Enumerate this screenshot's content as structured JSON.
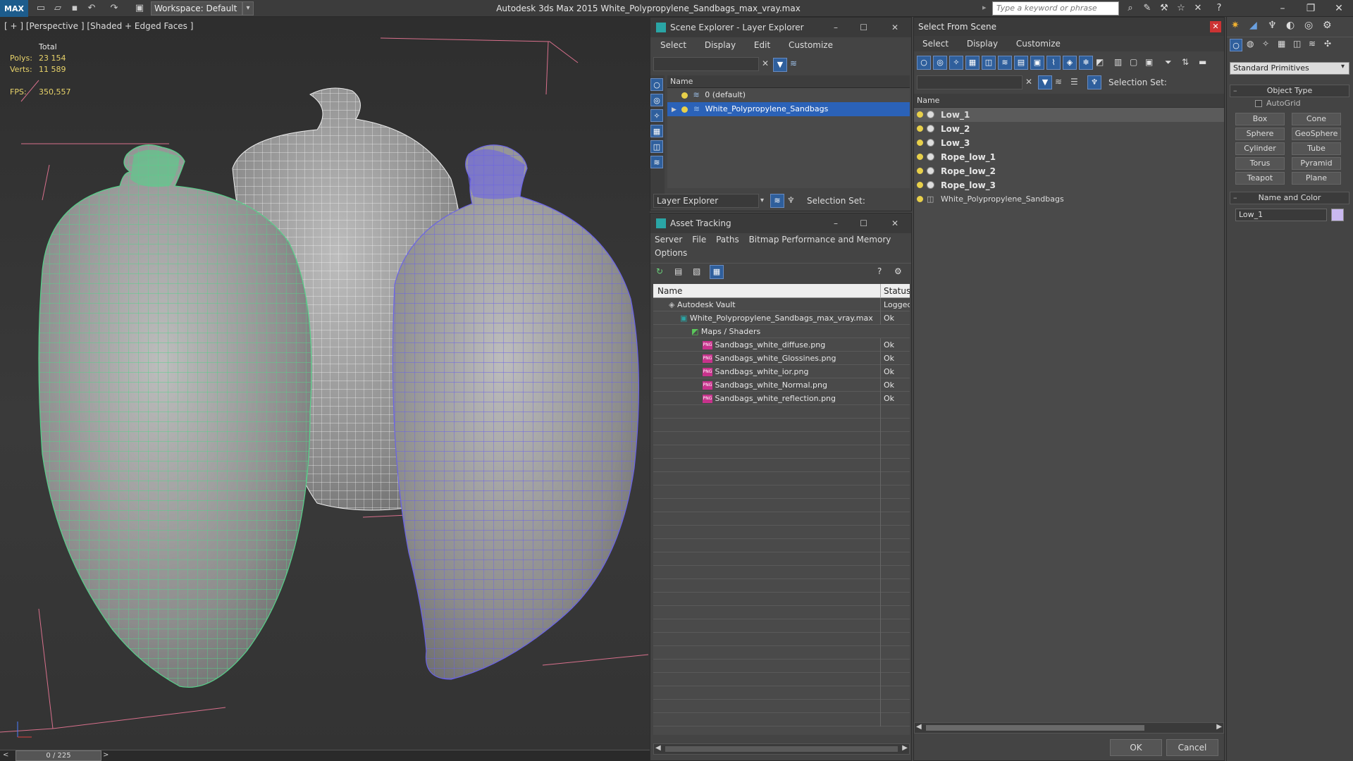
{
  "app": {
    "logo": "MAX",
    "title": "Autodesk 3ds Max  2015    White_Polypropylene_Sandbags_max_vray.max",
    "workspace": "Workspace: Default",
    "search_placeholder": "Type a keyword or phrase"
  },
  "viewport": {
    "label": "[ + ] [Perspective ] [Shaded + Edged Faces ]",
    "stats": {
      "total_label": "Total",
      "polys_label": "Polys:",
      "polys": "23 154",
      "verts_label": "Verts:",
      "verts": "11 589",
      "fps_label": "FPS:",
      "fps": "350,557"
    }
  },
  "timeline": {
    "frame": "0 / 225",
    "prev": "<",
    "next": ">"
  },
  "scene_explorer": {
    "title": "Scene Explorer - Layer Explorer",
    "menu": [
      "Select",
      "Display",
      "Edit",
      "Customize"
    ],
    "column": "Name",
    "layers": [
      "0 (default)",
      "White_Polypropylene_Sandbags"
    ],
    "footer_label": "Layer Explorer",
    "selection_set": "Selection Set:"
  },
  "asset_tracking": {
    "title": "Asset Tracking",
    "menu": [
      "Server",
      "File",
      "Paths",
      "Bitmap Performance and Memory",
      "Options"
    ],
    "col_name": "Name",
    "col_status": "Status",
    "rows": [
      {
        "name": "Autodesk Vault",
        "status": "Logged"
      },
      {
        "name": "White_Polypropylene_Sandbags_max_vray.max",
        "status": "Ok"
      },
      {
        "name": "Maps / Shaders",
        "status": ""
      },
      {
        "name": "Sandbags_white_diffuse.png",
        "status": "Ok"
      },
      {
        "name": "Sandbags_white_Glossines.png",
        "status": "Ok"
      },
      {
        "name": "Sandbags_white_ior.png",
        "status": "Ok"
      },
      {
        "name": "Sandbags_white_Normal.png",
        "status": "Ok"
      },
      {
        "name": "Sandbags_white_reflection.png",
        "status": "Ok"
      }
    ]
  },
  "select_from_scene": {
    "title": "Select From Scene",
    "menu": [
      "Select",
      "Display",
      "Customize"
    ],
    "selection_set": "Selection Set:",
    "column": "Name",
    "items": [
      "Low_1",
      "Low_2",
      "Low_3",
      "Rope_low_1",
      "Rope_low_2",
      "Rope_low_3",
      "White_Polypropylene_Sandbags"
    ],
    "ok": "OK",
    "cancel": "Cancel"
  },
  "command_panel": {
    "dropdown": "Standard Primitives",
    "object_type": "Object Type",
    "autogrid": "AutoGrid",
    "buttons": [
      "Box",
      "Cone",
      "Sphere",
      "GeoSphere",
      "Cylinder",
      "Tube",
      "Torus",
      "Pyramid",
      "Teapot",
      "Plane"
    ],
    "name_and_color": "Name and Color",
    "name_value": "Low_1",
    "color": "#c9b8f0"
  }
}
